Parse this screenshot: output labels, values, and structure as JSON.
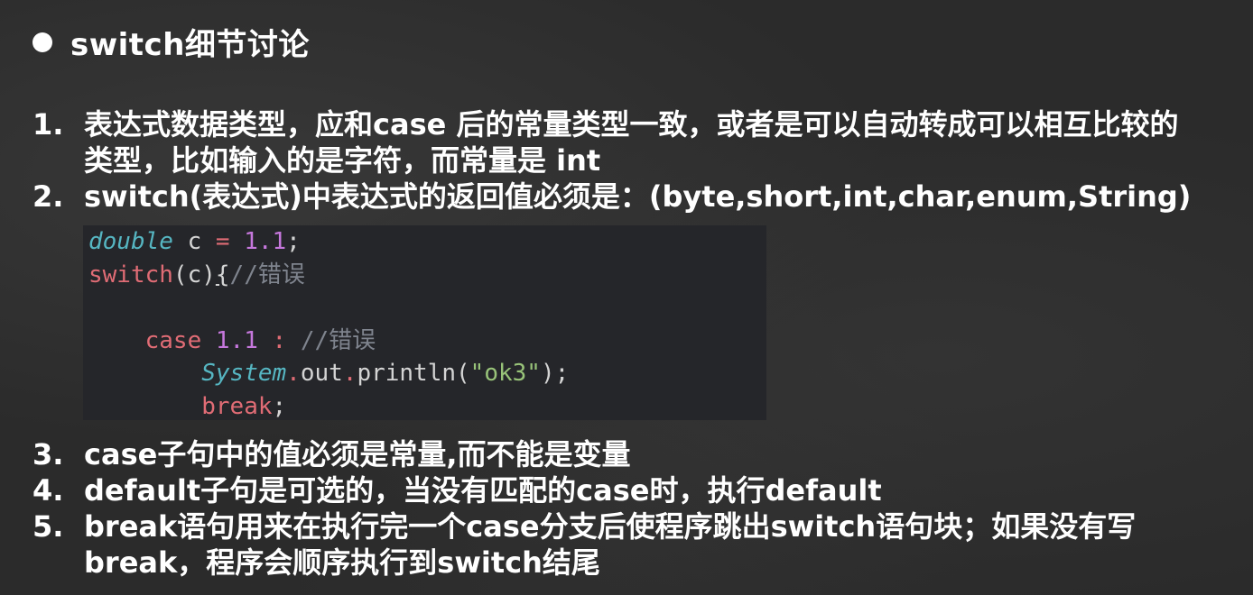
{
  "title": "switch细节讨论",
  "items_top": [
    {
      "num": "1.",
      "lines": [
        "表达式数据类型，应和case 后的常量类型一致，或者是可以自动转成可以相互比较的",
        "类型，比如输入的是字符，而常量是 int"
      ]
    },
    {
      "num": "2.",
      "lines": [
        "switch(表达式)中表达式的返回值必须是：(byte,short,int,char,enum,String)"
      ]
    }
  ],
  "code": {
    "line1": {
      "type": "double",
      "var": " c ",
      "eq": "=",
      "val": " 1.1",
      "semi": ";"
    },
    "line2": {
      "kw": "switch",
      "paren": "(c)",
      "brace": "{",
      "comment": "//错误"
    },
    "line4": {
      "indent": "    ",
      "kw": "case",
      "val": " 1.1",
      "colon": " :",
      "comment": " //错误"
    },
    "line5": {
      "indent": "        ",
      "cls": "System",
      "dot1": ".",
      "out": "out",
      "dot2": ".",
      "method": "println(",
      "str": "\"ok3\"",
      "end": ");"
    },
    "line6": {
      "indent": "        ",
      "kw": "break",
      "semi": ";"
    }
  },
  "items_bottom": [
    {
      "num": "3.",
      "lines": [
        "case子句中的值必须是常量,而不能是变量"
      ]
    },
    {
      "num": "4.",
      "lines": [
        "default子句是可选的，当没有匹配的case时，执行default"
      ]
    },
    {
      "num": "5.",
      "lines": [
        "break语句用来在执行完一个case分支后使程序跳出switch语句块；如果没有写",
        "break，程序会顺序执行到switch结尾"
      ]
    }
  ]
}
